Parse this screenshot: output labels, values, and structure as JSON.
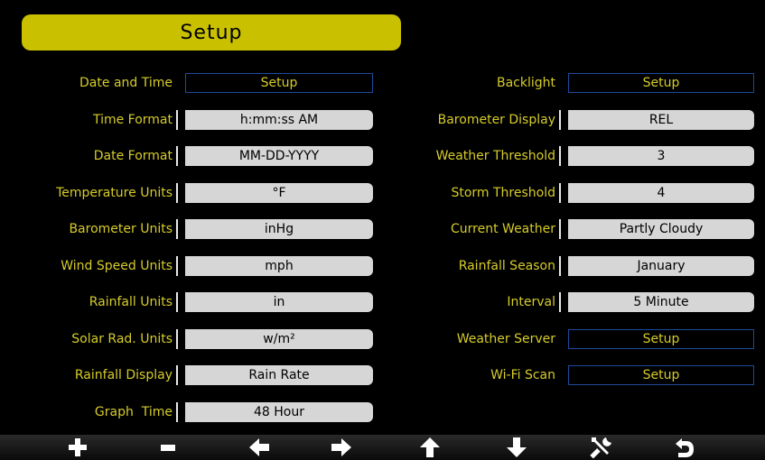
{
  "title": "Setup",
  "left_rows": [
    {
      "label": "Date and Time",
      "value": "Setup",
      "kind": "button"
    },
    {
      "label": "Time Format",
      "value": "h:mm:ss AM",
      "kind": "select"
    },
    {
      "label": "Date Format",
      "value": "MM-DD-YYYY",
      "kind": "select"
    },
    {
      "label": "Temperature Units",
      "value": "°F",
      "kind": "select"
    },
    {
      "label": "Barometer Units",
      "value": "inHg",
      "kind": "select"
    },
    {
      "label": "Wind Speed Units",
      "value": "mph",
      "kind": "select"
    },
    {
      "label": "Rainfall Units",
      "value": "in",
      "kind": "select"
    },
    {
      "label": "Solar Rad. Units",
      "value": "w/m²",
      "kind": "select"
    },
    {
      "label": "Rainfall Display",
      "value": "Rain Rate",
      "kind": "select"
    },
    {
      "label": "Graph  Time",
      "value": "48 Hour",
      "kind": "select"
    }
  ],
  "right_rows": [
    {
      "label": "Backlight",
      "value": "Setup",
      "kind": "button"
    },
    {
      "label": "Barometer Display",
      "value": "REL",
      "kind": "select"
    },
    {
      "label": "Weather Threshold",
      "value": "3",
      "kind": "select"
    },
    {
      "label": "Storm Threshold",
      "value": "4",
      "kind": "select"
    },
    {
      "label": "Current Weather",
      "value": "Partly Cloudy",
      "kind": "select"
    },
    {
      "label": "Rainfall Season",
      "value": "January",
      "kind": "select"
    },
    {
      "label": "Interval",
      "value": "5 Minute",
      "kind": "select"
    },
    {
      "label": "Weather Server",
      "value": "Setup",
      "kind": "button"
    },
    {
      "label": "Wi-Fi Scan",
      "value": "Setup",
      "kind": "button"
    }
  ],
  "toolbar": [
    {
      "name": "plus-icon"
    },
    {
      "name": "minus-icon"
    },
    {
      "name": "arrow-left-icon"
    },
    {
      "name": "arrow-right-icon"
    },
    {
      "name": "arrow-up-icon"
    },
    {
      "name": "arrow-down-icon"
    },
    {
      "name": "tools-icon"
    },
    {
      "name": "return-icon"
    }
  ],
  "colors": {
    "background": "#000000",
    "title_bar": "#c9c100",
    "label_text": "#d6cc2a",
    "value_field": "#d6d6d6",
    "button_border": "#1e4a9c"
  }
}
